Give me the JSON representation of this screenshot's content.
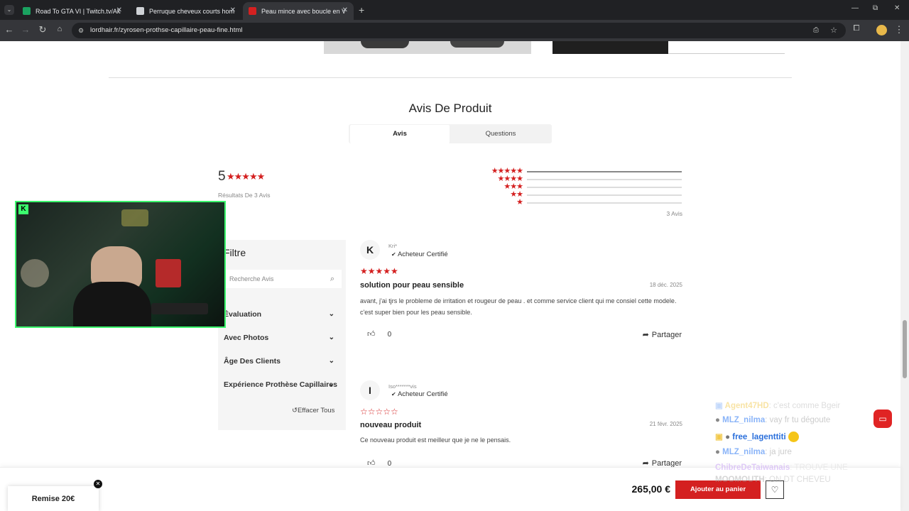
{
  "browser": {
    "tabs": [
      {
        "title": "Road To GTA VI | Twitch.tv/Akan",
        "favicon_color": "#1aa260",
        "active": false
      },
      {
        "title": "Perruque cheveux courts homme",
        "favicon_color": "#cfd2d6",
        "active": false
      },
      {
        "title": "Peau mince avec boucle en V -",
        "favicon_color": "#d42020",
        "active": true
      }
    ],
    "new_tab": "+",
    "url": "lordhair.fr/zyrosen-prothse-capillaire-peau-fine.html"
  },
  "reviews_section": {
    "title": "Avis De Produit",
    "tabs": [
      "Avis",
      "Questions"
    ],
    "rating_value": "5",
    "stars": "★★★★★",
    "results_text": "Résultats De 3 Avis",
    "count_text": "3 Avis",
    "histogram_fill": [
      1,
      0,
      0,
      0,
      0
    ]
  },
  "filter": {
    "title": "Filtre",
    "search_placeholder": "Recherche Avis",
    "items": [
      "Évaluation",
      "Avec Photos",
      "Âge Des Clients",
      "Expérience Prothèse Capillaires"
    ],
    "clear_all": "Effacer Tous"
  },
  "reviews": [
    {
      "initial": "K",
      "author": "Kri*",
      "badge": "Acheteur Certifié",
      "stars": "★★★★★",
      "title": "solution pour peau sensible",
      "date": "18 déc. 2025",
      "body": "avant, j'ai tjrs le probleme de irritation et rougeur de peau . et comme service client qui me consiel cette modele. c'est super bien pour les peau sensible.",
      "likes": "0",
      "share": "Partager"
    },
    {
      "initial": "I",
      "author": "Iso*******vis",
      "badge": "Acheteur Certifié",
      "stars": "☆☆☆☆☆",
      "title": "nouveau produit",
      "date": "21 févr. 2025",
      "body": "Ce nouveau produit est meilleur que je ne le pensais.",
      "likes": "0",
      "share": "Partager"
    }
  ],
  "bottom_bar": {
    "discount": "Remise 20€",
    "price": "265,00 €",
    "add_to_cart": "Ajouter au panier"
  },
  "chat_overlay": [
    {
      "user": "Agent47HD",
      "message": ": c'est comme Bgeir",
      "color": "#f2c94c"
    },
    {
      "user": "MLZ_nilma",
      "message": ": vay fr tu dégoute",
      "color": "#8ab4f8"
    },
    {
      "user": "free_lagenttiti",
      "message": "",
      "color": "#2a6fdb"
    },
    {
      "user": "MLZ_nilma",
      "message": ": ja jure",
      "color": "#8ab4f8"
    },
    {
      "user": "ChibreDeTaiwanais",
      "message": ": TROUVE UNE",
      "color": "#c8a2f5"
    },
    {
      "user": "MOOMOUTH",
      "message": ": ON DT CHEVEU",
      "color": "#ffffff"
    }
  ],
  "colors": {
    "accent_red": "#d42020",
    "webcam_frame": "#3cff6e"
  }
}
